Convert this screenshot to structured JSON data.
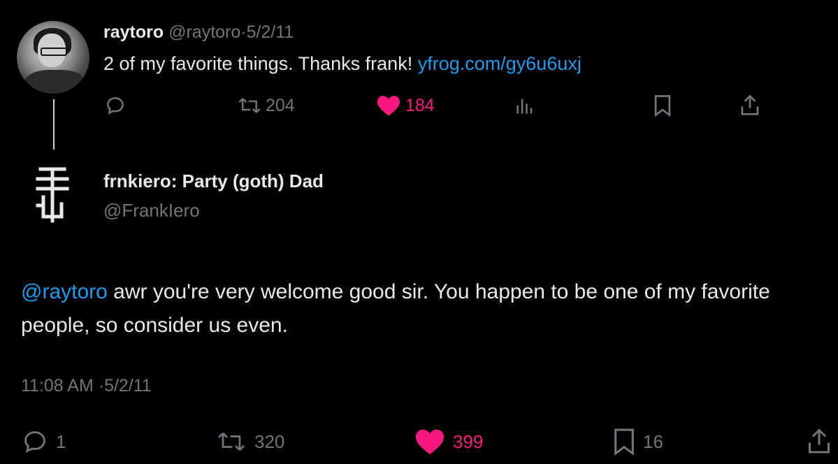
{
  "tweet1": {
    "display_name": "raytoro",
    "handle": "@raytoro",
    "separator": "·",
    "date": "5/2/11",
    "text": "2 of my favorite things. Thanks frank!",
    "link": "yfrog.com/gy6u6uxj",
    "actions": {
      "retweets": "204",
      "likes": "184"
    }
  },
  "tweet2": {
    "display_name": "frnkiero: Party (goth) Dad",
    "handle": "@FrankIero",
    "mention": "@raytoro",
    "text": "awr you're very welcome good sir. You happen to be one of my favorite people, so consider us even.",
    "time": "11:08 AM",
    "separator": "·",
    "date": "5/2/11",
    "actions": {
      "replies": "1",
      "retweets": "320",
      "likes": "399",
      "bookmarks": "16"
    }
  },
  "colors": {
    "background": "#000000",
    "text": "#e7e9ea",
    "muted": "#71767b",
    "link": "#1d9bf0",
    "like": "#f91880"
  }
}
